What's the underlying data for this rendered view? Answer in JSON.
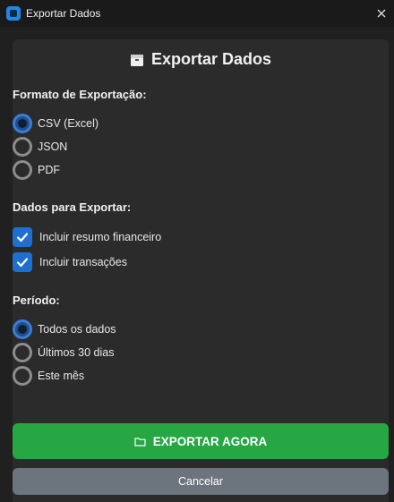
{
  "window": {
    "title": "Exportar Dados"
  },
  "header": {
    "title": "Exportar Dados",
    "icon": "box-icon"
  },
  "format": {
    "label": "Formato de Exportação:",
    "options": [
      {
        "label": "CSV (Excel)",
        "selected": true
      },
      {
        "label": "JSON",
        "selected": false
      },
      {
        "label": "PDF",
        "selected": false
      }
    ]
  },
  "data_section": {
    "label": "Dados para Exportar:",
    "items": [
      {
        "label": "Incluir resumo financeiro",
        "checked": true
      },
      {
        "label": "Incluir transações",
        "checked": true
      }
    ]
  },
  "period": {
    "label": "Período:",
    "options": [
      {
        "label": "Todos os dados",
        "selected": true
      },
      {
        "label": "Últimos 30 dias",
        "selected": false
      },
      {
        "label": "Este mês",
        "selected": false
      }
    ]
  },
  "actions": {
    "export_label": "EXPORTAR AGORA",
    "cancel_label": "Cancelar"
  },
  "colors": {
    "accent": "#1f6fd1",
    "export_button": "#27a644",
    "cancel_button": "#6c757d"
  }
}
